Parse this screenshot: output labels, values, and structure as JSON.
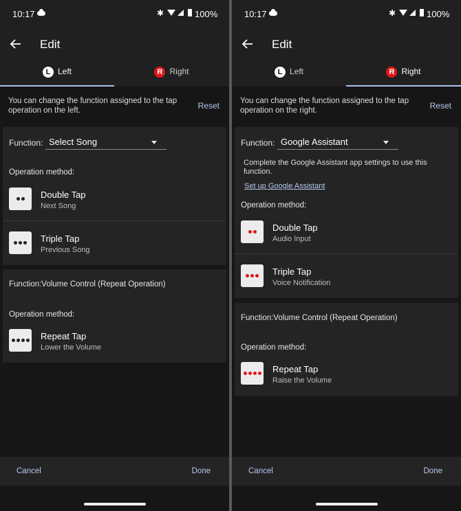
{
  "status": {
    "time": "10:17",
    "battery": "100%",
    "bluetooth_glyph": "✱"
  },
  "app": {
    "title": "Edit",
    "cancel": "Cancel",
    "done": "Done",
    "reset": "Reset"
  },
  "tabs": [
    {
      "badge": "L",
      "label": "Left"
    },
    {
      "badge": "R",
      "label": "Right"
    }
  ],
  "left": {
    "active_tab": "Left",
    "description": "You can change the function assigned to the tap operation on the left.",
    "function_label": "Function:",
    "function_value": "Select Song",
    "operation_method_label": "Operation method:",
    "operations": [
      {
        "name": "Double Tap",
        "sub": "Next Song",
        "dots": 2
      },
      {
        "name": "Triple Tap",
        "sub": "Previous Song",
        "dots": 3
      }
    ],
    "volume_function": "Function:Volume Control (Repeat Operation)",
    "volume_operation_method_label": "Operation method:",
    "volume_operation": {
      "name": "Repeat Tap",
      "sub": "Lower the Volume",
      "dots": 4
    }
  },
  "right": {
    "active_tab": "Right",
    "description": "You can change the function assigned to the tap operation on the right.",
    "function_label": "Function:",
    "function_value": "Google Assistant",
    "note": "Complete the Google Assistant app settings to use this function.",
    "link": "Set up Google Assistant",
    "operation_method_label": "Operation method:",
    "operations": [
      {
        "name": "Double Tap",
        "sub": "Audio Input",
        "dots": 2
      },
      {
        "name": "Triple Tap",
        "sub": "Voice Notification",
        "dots": 3
      }
    ],
    "volume_function": "Function:Volume Control (Repeat Operation)",
    "volume_operation_method_label": "Operation method:",
    "volume_operation": {
      "name": "Repeat Tap",
      "sub": "Raise the Volume",
      "dots": 4
    }
  },
  "colors": {
    "accent": "#a9c3ef",
    "link": "#b8caf0",
    "right_badge": "#e01818",
    "dot_red": "#e01818"
  },
  "icons": [
    "back-arrow-icon",
    "cloud-icon",
    "bluetooth-icon",
    "wifi-icon",
    "signal-icon",
    "battery-icon",
    "dropdown-caret-icon",
    "tap-dots-icon"
  ]
}
